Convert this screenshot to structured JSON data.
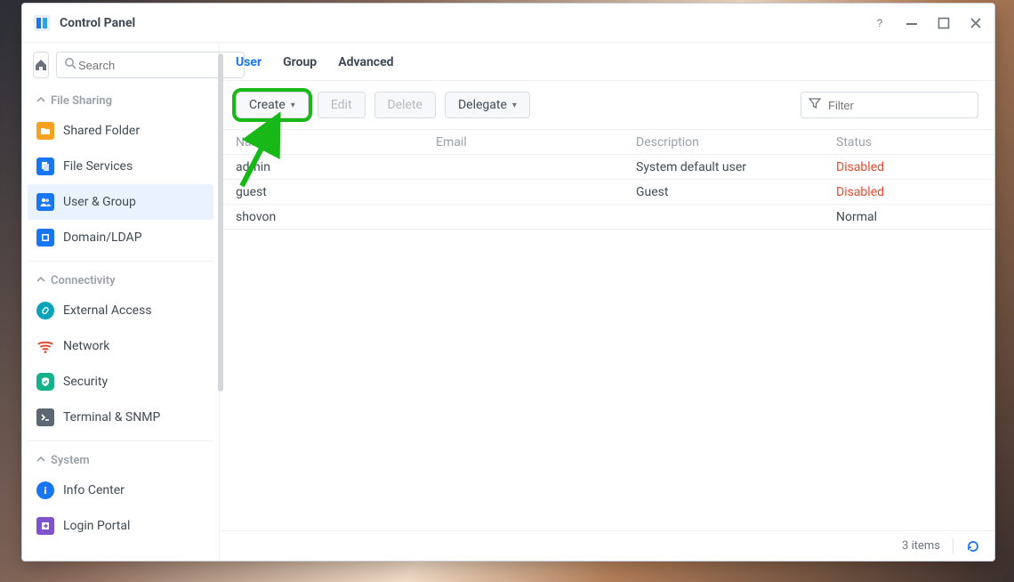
{
  "window": {
    "title": "Control Panel"
  },
  "search": {
    "placeholder": "Search"
  },
  "sidebar": {
    "sections": [
      {
        "title": "File Sharing",
        "items": [
          {
            "label": "Shared Folder"
          },
          {
            "label": "File Services"
          },
          {
            "label": "User & Group",
            "selected": true
          },
          {
            "label": "Domain/LDAP"
          }
        ]
      },
      {
        "title": "Connectivity",
        "items": [
          {
            "label": "External Access"
          },
          {
            "label": "Network"
          },
          {
            "label": "Security"
          },
          {
            "label": "Terminal & SNMP"
          }
        ]
      },
      {
        "title": "System",
        "items": [
          {
            "label": "Info Center"
          },
          {
            "label": "Login Portal"
          }
        ]
      }
    ]
  },
  "tabs": [
    {
      "label": "User",
      "active": true
    },
    {
      "label": "Group"
    },
    {
      "label": "Advanced"
    }
  ],
  "toolbar": {
    "create": "Create",
    "edit": "Edit",
    "delete": "Delete",
    "delegate": "Delegate",
    "filter_placeholder": "Filter"
  },
  "columns": {
    "name": "Name",
    "email": "Email",
    "description": "Description",
    "status": "Status"
  },
  "rows": [
    {
      "name": "admin",
      "email": "",
      "description": "System default user",
      "status": "Disabled",
      "status_kind": "disabled"
    },
    {
      "name": "guest",
      "email": "",
      "description": "Guest",
      "status": "Disabled",
      "status_kind": "disabled"
    },
    {
      "name": "shovon",
      "email": "",
      "description": "",
      "status": "Normal",
      "status_kind": "normal"
    }
  ],
  "footer": {
    "count_text": "3 items"
  },
  "colors": {
    "accent": "#1976f2",
    "danger": "#e24a2e",
    "highlight": "#17b817"
  }
}
